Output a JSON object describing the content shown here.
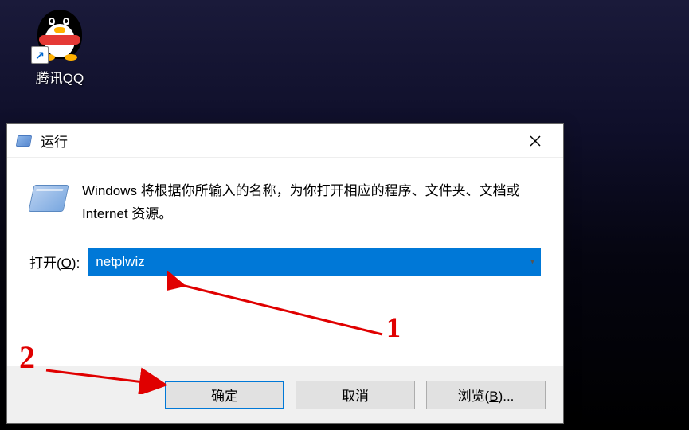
{
  "desktop": {
    "icon_label": "腾讯QQ"
  },
  "dialog": {
    "title": "运行",
    "info_text": "Windows 将根据你所输入的名称，为你打开相应的程序、文件夹、文档或 Internet 资源。",
    "open_label_prefix": "打开(",
    "open_label_key": "O",
    "open_label_suffix": "):",
    "command_value": "netplwiz",
    "buttons": {
      "ok": "确定",
      "cancel": "取消",
      "browse_prefix": "浏览(",
      "browse_key": "B",
      "browse_suffix": ")..."
    }
  },
  "annotations": {
    "digit1": "1",
    "digit2": "2"
  }
}
